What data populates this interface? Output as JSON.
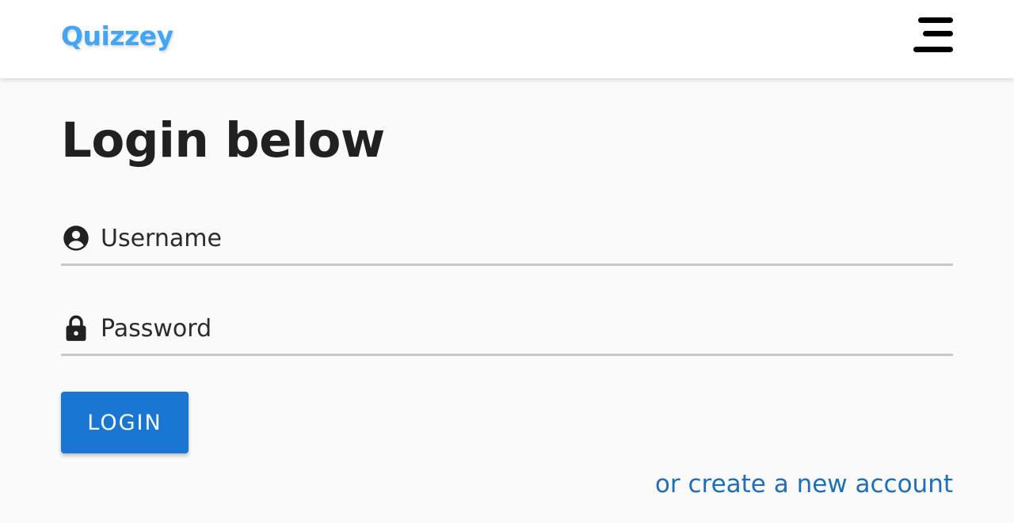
{
  "header": {
    "logo_part1": "Qui",
    "logo_part2": "zzey",
    "menu_icon": "hamburger-menu-icon"
  },
  "login": {
    "title": "Login below",
    "username": {
      "icon": "account-circle-icon",
      "placeholder": "Username",
      "value": ""
    },
    "password": {
      "icon": "lock-icon",
      "placeholder": "Password",
      "value": ""
    },
    "submit_label": "LOGIN",
    "create_account_label": "or create a new account"
  },
  "colors": {
    "primary": "#1976d2",
    "logo_accent": "#42a5f5",
    "link": "#1e6fb8"
  }
}
